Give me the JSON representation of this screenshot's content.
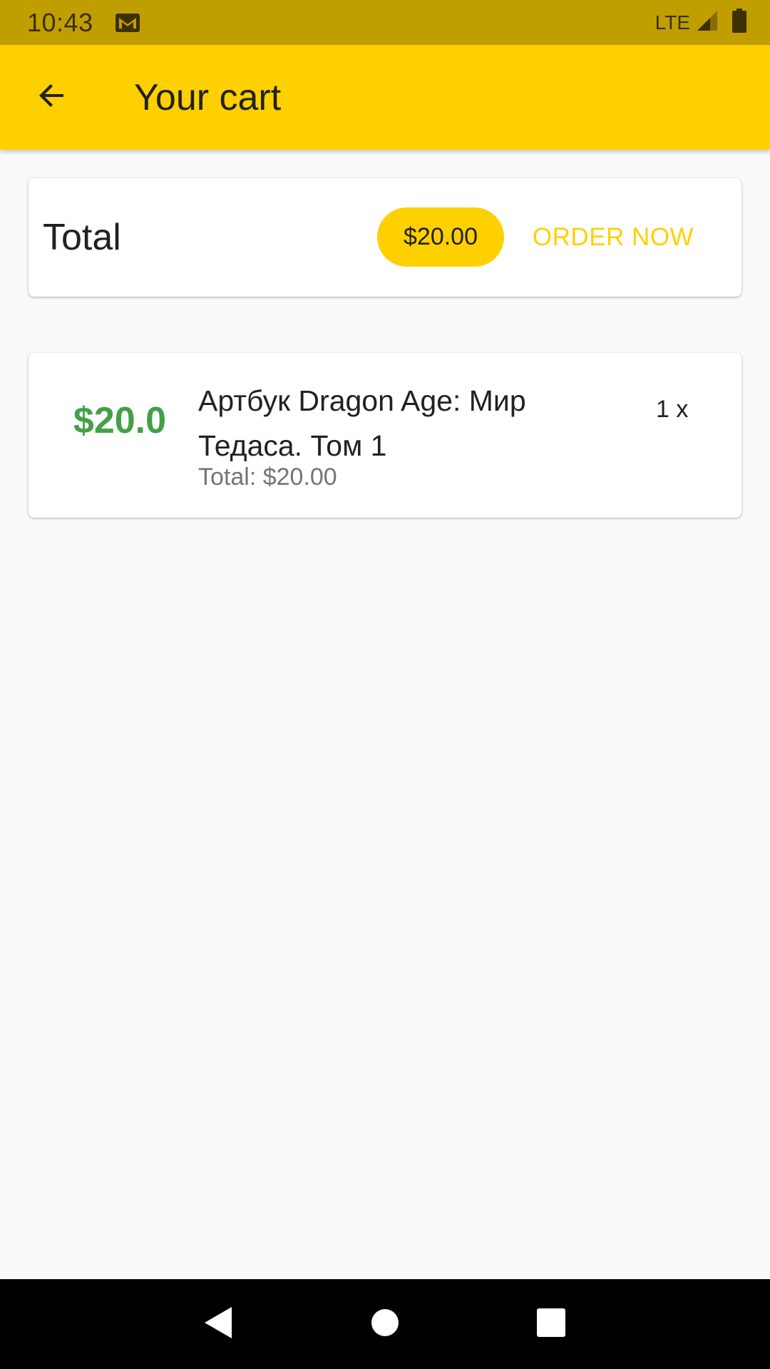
{
  "status_bar": {
    "time": "10:43",
    "network": "LTE",
    "icons": [
      "mail-icon",
      "signal-icon",
      "battery-icon"
    ]
  },
  "app_bar": {
    "title": "Your cart",
    "back_icon": "arrow-back-icon",
    "background_color": "#ffd000"
  },
  "summary": {
    "label": "Total",
    "amount": "$20.00",
    "order_button": "ORDER NOW",
    "accent_color": "#ffd000"
  },
  "cart_items": [
    {
      "price": "$20.0",
      "title": "Артбук Dragon Age: Мир Тедаса. Том 1",
      "subtotal": "Total: $20.00",
      "quantity": "1 x",
      "price_color": "#43a047"
    }
  ],
  "nav_bar": {
    "buttons": [
      "back-triangle-icon",
      "home-circle-icon",
      "recents-square-icon"
    ]
  }
}
